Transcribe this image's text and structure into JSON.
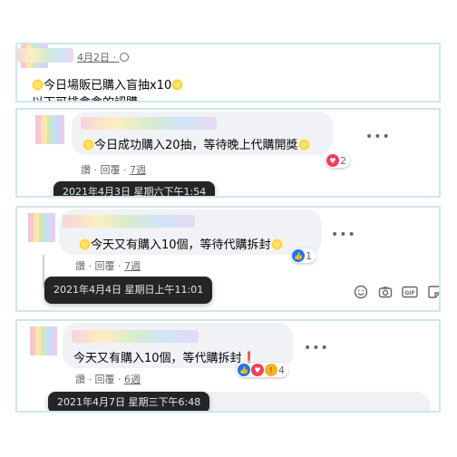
{
  "post": {
    "date": "4月2日 · ",
    "globe_icon": "globe-icon",
    "line1_text": "今日場販已購入盲抽x10",
    "line2_partial": "以下可排盒盒的認購"
  },
  "comments": [
    {
      "text": "今日成功購入20抽，等待晚上代購開獎",
      "reactions_count": "2",
      "like": "讚",
      "reply": "回覆",
      "time": "7週",
      "tooltip": "2021年4月3日 星期六下午1:54"
    },
    {
      "text": "今天又有購入10個，等待代購拆封",
      "reactions_count": "1",
      "like": "讚",
      "reply": "回覆",
      "time": "7週",
      "tooltip": "2021年4月4日 星期日上午11:01"
    },
    {
      "text": "今天又有購入10個，等代購拆封",
      "exclaim": "❗",
      "reactions_count": "4",
      "like": "讚",
      "reply": "回覆",
      "time": "6週",
      "tooltip": "2021年4月7日 星期三下午6:48"
    }
  ],
  "meta_sep": " · ",
  "more_glyph": "•••",
  "colors": {
    "panel_border": "#cfe7e8",
    "bubble": "#f0f2f5",
    "tooltip": "#242526",
    "love": "#f33e58",
    "like": "#1877f2"
  }
}
